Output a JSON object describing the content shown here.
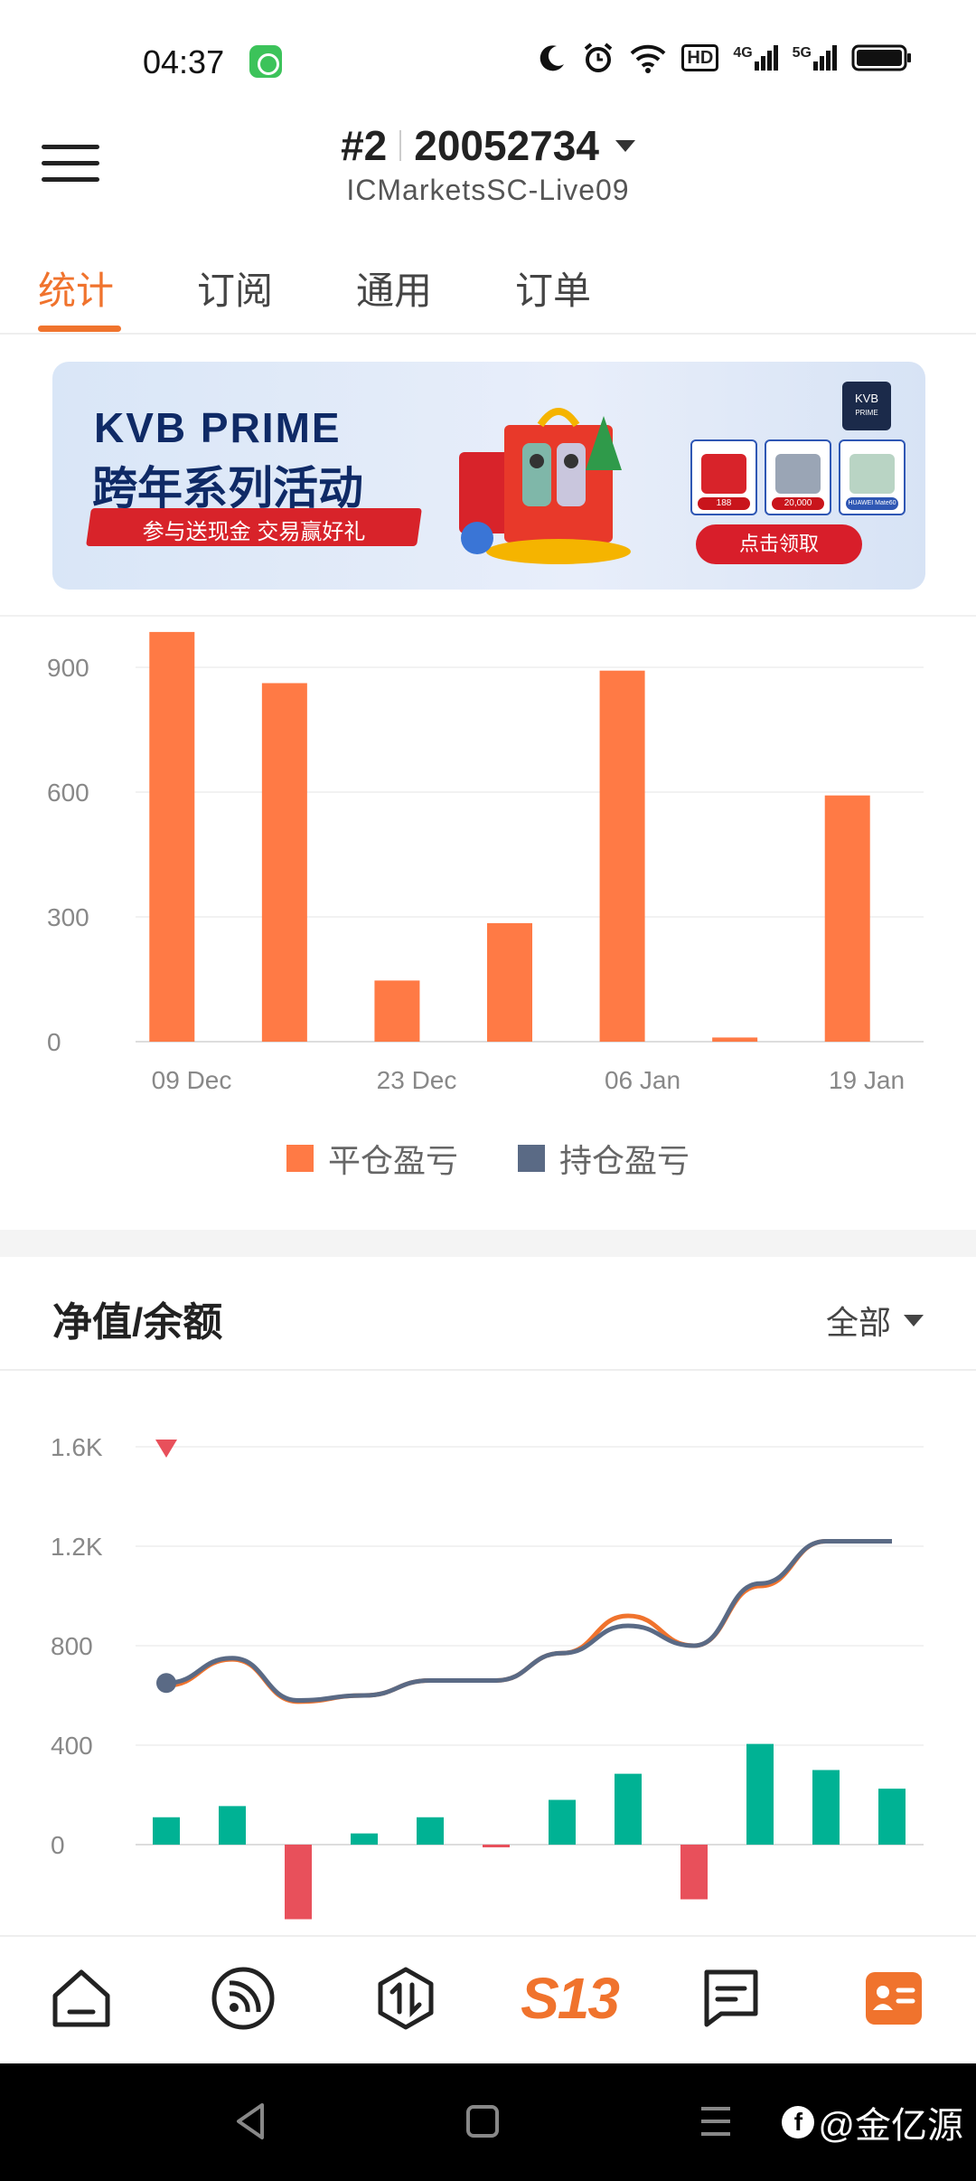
{
  "status_bar": {
    "time": "04:37",
    "icons": [
      "app-notification-icon",
      "moon-icon",
      "alarm-icon",
      "wifi-icon",
      "hd-icon",
      "4g-signal-icon",
      "5g-signal-icon",
      "battery-icon"
    ],
    "hd_label": "HD",
    "g4_label": "4G",
    "g5_label": "5G"
  },
  "header": {
    "account_index": "#2",
    "account_id": "20052734",
    "server": "ICMarketsSC-Live09"
  },
  "tabs": [
    {
      "label": "统计",
      "active": true
    },
    {
      "label": "订阅",
      "active": false
    },
    {
      "label": "通用",
      "active": false
    },
    {
      "label": "订单",
      "active": false
    }
  ],
  "banner": {
    "title_line1": "KVB PRIME",
    "title_line2": "跨年系列活动",
    "ribbon": "参与送现金 交易赢好礼",
    "logo_line1": "KVB",
    "logo_line2": "PRIME",
    "cta": "点击领取",
    "prize_tags": [
      "188",
      "20,000",
      "HUAWEI Mate60"
    ]
  },
  "colors": {
    "accent": "#f0732d",
    "bar_closed": "#ff7a45",
    "bar_open": "#5a6a85",
    "positive": "#00b294",
    "negative": "#e8505b",
    "equity_line": "#5a6a85",
    "balance_line": "#f0732d"
  },
  "chart_data": [
    {
      "type": "bar",
      "categories": [
        "09 Dec",
        "",
        "",
        "23 Dec",
        "",
        "06 Jan",
        "",
        "19 Jan"
      ],
      "x_tick_labels": [
        "09 Dec",
        "23 Dec",
        "06 Jan",
        "19 Jan"
      ],
      "series": [
        {
          "name": "平仓盈亏",
          "values": [
            985,
            862,
            147,
            285,
            892,
            10,
            592
          ]
        },
        {
          "name": "持仓盈亏",
          "values": [
            0,
            0,
            0,
            0,
            0,
            0,
            0
          ]
        }
      ],
      "y_ticks": [
        "0",
        "300",
        "600",
        "900"
      ],
      "ylim": [
        0,
        1000
      ],
      "legend": "bottom"
    },
    {
      "type": "line",
      "title": "净值/余额",
      "filter": "全部",
      "y_ticks": [
        "0",
        "400",
        "800",
        "1.2K",
        "1.6K"
      ],
      "ylim": [
        -200,
        1700
      ],
      "line_series": [
        {
          "values": [
            650,
            750,
            580,
            600,
            660,
            660,
            770,
            880,
            800,
            1050,
            1220,
            1220
          ]
        },
        {
          "values": [
            640,
            745,
            575,
            600,
            660,
            660,
            770,
            920,
            800,
            1040,
            1220,
            1220
          ]
        }
      ],
      "bar_series": {
        "values": [
          110,
          155,
          -300,
          45,
          110,
          -10,
          180,
          285,
          -220,
          405,
          300,
          225
        ]
      }
    }
  ],
  "bottom_nav": {
    "items": [
      "home-icon",
      "signal-feed-icon",
      "trade-icon",
      "s13-logo",
      "messages-icon",
      "profile-card-icon"
    ],
    "center_label": "S13"
  },
  "watermark": "@金亿源"
}
